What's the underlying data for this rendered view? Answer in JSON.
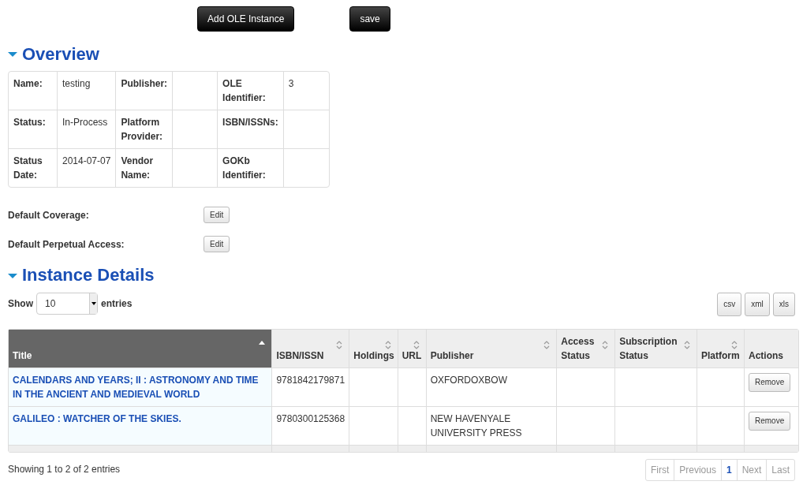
{
  "top_buttons": [
    "Add OLE Instance",
    "save"
  ],
  "overview": {
    "title": "Overview",
    "expanded": true,
    "rows": [
      [
        {
          "label": "Name:",
          "value": "testing"
        },
        {
          "label": "Publisher:"
        },
        {
          "label": "OLE Identifier:",
          "value": "3"
        }
      ],
      [
        {
          "label": "Status:",
          "value": "In-Process"
        },
        {
          "label": "Platform Provider:"
        },
        {
          "label": "ISBN/ISSNs:"
        }
      ],
      [
        {
          "label": "Status Date:",
          "value": "2014-07-07"
        },
        {
          "label": "Vendor Name:"
        },
        {
          "label": "GOKb Identifier:"
        }
      ]
    ]
  },
  "defaults": [
    {
      "label": "Default Coverage:",
      "button": "Edit"
    },
    {
      "label": "Default Perpetual Access:",
      "button": "Edit"
    }
  ],
  "instance_details": {
    "title": "Instance Details",
    "expanded": true,
    "length": {
      "before": "Show",
      "value": "10",
      "after": "entries"
    },
    "export_buttons": [
      "csv",
      "xml",
      "xls"
    ],
    "columns": [
      {
        "label": "Title",
        "sortable": true,
        "selected": true
      },
      {
        "label": "ISBN/ISSN",
        "sortable": true,
        "selected": false
      },
      {
        "label": "Holdings",
        "sortable": true,
        "selected": false
      },
      {
        "label": "URL",
        "sortable": true,
        "selected": false
      },
      {
        "label": "Publisher",
        "sortable": true,
        "selected": false
      },
      {
        "label": "Access Status",
        "sortable": true,
        "selected": false
      },
      {
        "label": "Subscription Status",
        "sortable": true,
        "selected": false
      },
      {
        "label": "Platform",
        "sortable": true,
        "selected": false
      },
      {
        "label": "Actions",
        "sortable": false,
        "selected": false
      }
    ],
    "rows": [
      {
        "title": "CALENDARS AND YEARS; II : ASTRONOMY AND TIME IN THE ANCIENT AND MEDIEVAL WORLD",
        "isbn": "9781842179871",
        "publisher": "OXFORDOXBOW",
        "action": "Remove"
      },
      {
        "title": "GALILEO : WATCHER OF THE SKIES.",
        "isbn": "9780300125368",
        "publisher": "NEW HAVENYALE UNIVERSITY PRESS",
        "action": "Remove"
      }
    ],
    "info": "Showing 1 to 2 of 2 entries",
    "pagination": [
      {
        "label": "First",
        "disabled": true,
        "selected": false
      },
      {
        "label": "Previous",
        "disabled": true,
        "selected": false
      },
      {
        "label": "1",
        "disabled": false,
        "selected": true
      },
      {
        "label": "Next",
        "disabled": true,
        "selected": false
      },
      {
        "label": "Last",
        "disabled": true,
        "selected": false
      }
    ]
  }
}
